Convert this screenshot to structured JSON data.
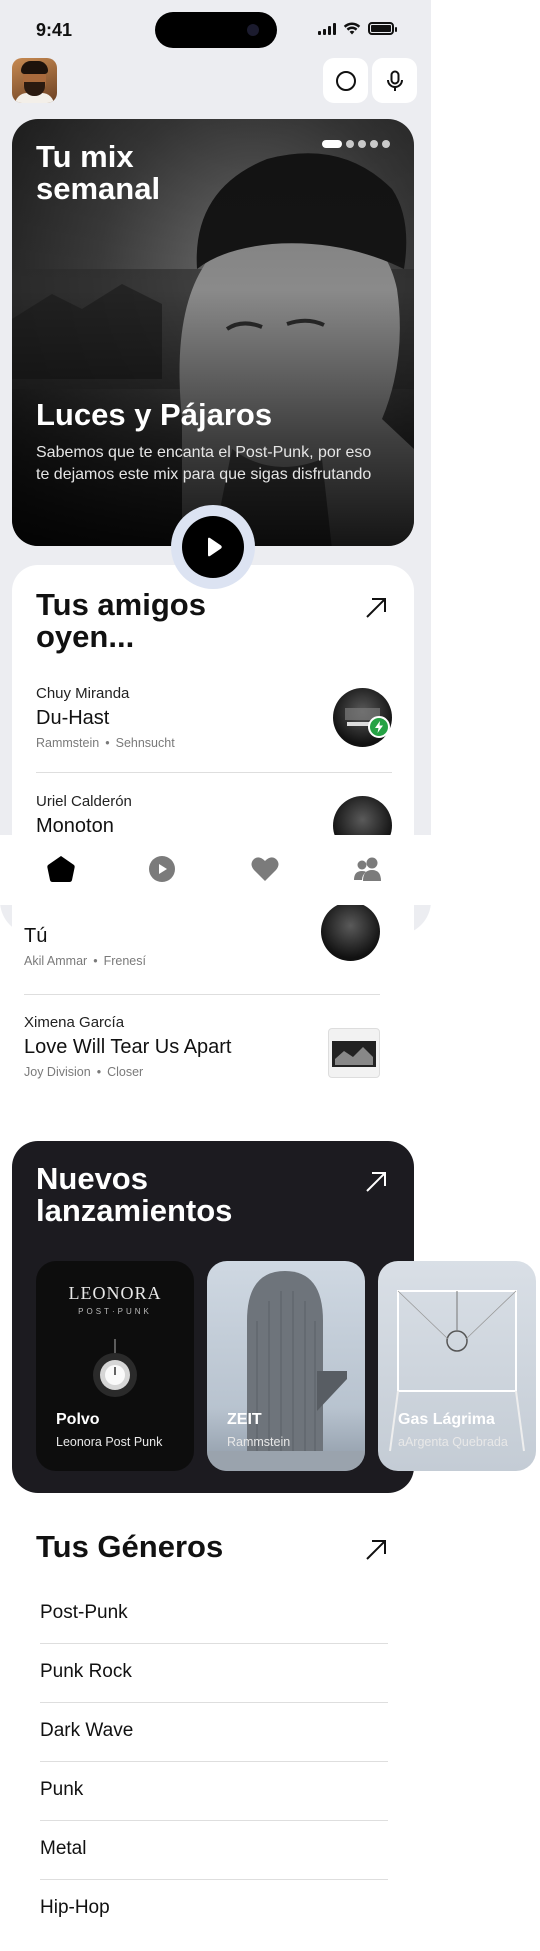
{
  "status": {
    "time": "9:41"
  },
  "hero": {
    "title": "Tu mix semanal",
    "album": "Luces y Pájaros",
    "description": "Sabemos que te encanta el Post-Punk, por eso te dejamos este mix para que sigas disfrutando",
    "carousel": {
      "total": 5,
      "active": 1
    }
  },
  "friends": {
    "title": "Tus amigos oyen...",
    "items": [
      {
        "name": "Chuy Miranda",
        "song": "Du-Hast",
        "artist": "Rammstein",
        "album": "Sehnsucht"
      },
      {
        "name": "Uriel Calderón",
        "song": "Monoton",
        "artist": "",
        "album": ""
      },
      {
        "name": "",
        "song": "Tú",
        "artist": "Akil Ammar",
        "album": "Frenesí"
      },
      {
        "name": "Ximena García",
        "song": "Love Will Tear Us Apart",
        "artist": "Joy Division",
        "album": "Closer"
      }
    ],
    "separator": "•"
  },
  "tabbar": {
    "active": "home"
  },
  "releases": {
    "title": "Nuevos lanzamientos",
    "items": [
      {
        "title": "Polvo",
        "artist": "Leonora Post Punk",
        "cover_text": "LEONORA",
        "cover_subtext": "POST·PUNK"
      },
      {
        "title": "ZEIT",
        "artist": "Rammstein"
      },
      {
        "title": "Gas Lágrima",
        "artist": "aArgenta Quebrada"
      }
    ]
  },
  "genres": {
    "title": "Tus Géneros",
    "items": [
      "Post-Punk",
      "Punk Rock",
      "Dark Wave",
      "Punk",
      "Metal",
      "Hip-Hop"
    ]
  },
  "colors": {
    "accent_green": "#25a244",
    "dark_card": "#1c1b20",
    "play_ring": "#dce3f2"
  }
}
